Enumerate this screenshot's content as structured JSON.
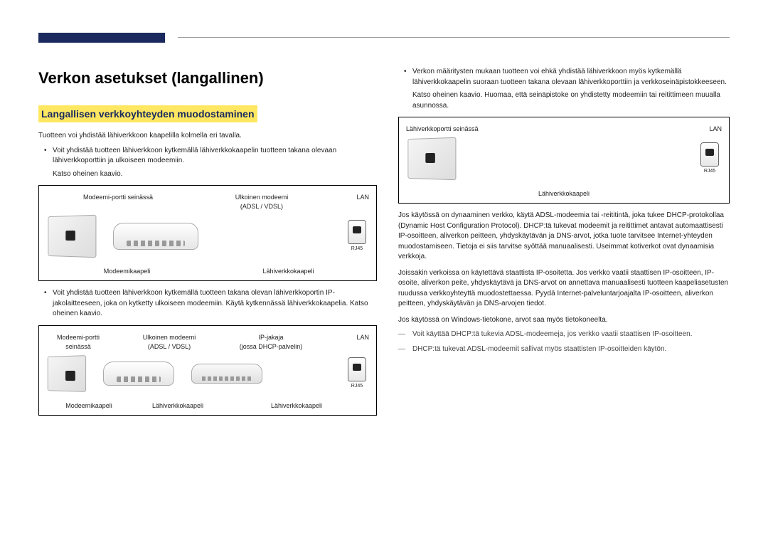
{
  "heading": "Verkon asetukset (langallinen)",
  "subheading": "Langallisen verkkoyhteyden muodostaminen",
  "intro": "Tuotteen voi yhdistää lähiverkkoon kaapelilla kolmella eri tavalla.",
  "bullet1": "Voit yhdistää tuotteen lähiverkkoon kytkemällä lähiverkkokaapelin tuotteen takana olevaan lähiverkkoporttiin ja ulkoiseen modeemiin.",
  "bullet1_sub": "Katso oheinen kaavio.",
  "bullet2": "Voit yhdistää tuotteen lähiverkkoon kytkemällä tuotteen takana olevan lähiverkkoportin IP-jakolaitteeseen, joka on kytketty ulkoiseen modeemiin. Käytä kytkennässä lähiverkkokaapelia. Katso oheinen kaavio.",
  "right_bullet": "Verkon määritysten mukaan tuotteen voi ehkä yhdistää lähiverkkoon myös kytkemällä lähiverkkokaapelin suoraan tuotteen takana olevaan lähiverkkoporttiin ja verkkoseinäpistokkeeseen.",
  "right_bullet_sub": "Katso oheinen kaavio. Huomaa, että seinäpistoke on yhdistetty modeemiin tai reitittimeen muualla asunnossa.",
  "right_p1": "Jos käytössä on dynaaminen verkko, käytä ADSL-modeemia tai -reititintä, joka tukee DHCP-protokollaa (Dynamic Host Configuration Protocol). DHCP:tä tukevat modeemit ja reitittimet antavat automaattisesti IP-osoitteen, aliverkon peitteen, yhdyskäytävän ja DNS-arvot, jotka tuote tarvitsee Internet-yhteyden muodostamiseen. Tietoja ei siis tarvitse syöttää manuaalisesti. Useimmat kotiverkot ovat dynaamisia verkkoja.",
  "right_p2": "Joissakin verkoissa on käytettävä staattista IP-osoitetta. Jos verkko vaatii staattisen IP-osoitteen, IP-osoite, aliverkon peite, yhdyskäytävä ja DNS-arvot on annettava manuaalisesti tuotteen kaapeliasetusten ruudussa verkkoyhteyttä muodostettaessa. Pyydä Internet-palveluntarjoajalta IP-osoitteen, aliverkon peitteen, yhdyskäytävän ja DNS-arvojen tiedot.",
  "right_p3": "Jos käytössä on Windows-tietokone, arvot saa myös tietokoneelta.",
  "note1": "Voit käyttää DHCP:tä tukevia ADSL-modeemeja, jos verkko vaatii staattisen IP-osoitteen.",
  "note2": "DHCP:tä tukevat ADSL-modeemit sallivat myös staattisten IP-osoitteiden käytön.",
  "labels": {
    "modem_port": "Modeemi-portti seinässä",
    "ext_modem": "Ulkoinen modeemi",
    "adsl_vdsl": "(ADSL / VDSL)",
    "ip_share": "IP-jakaja",
    "ip_share_sub": "(jossa DHCP-palvelin)",
    "lan": "LAN",
    "rj45": "RJ45",
    "modem_cable": "Modeemikaapeli",
    "lan_cable": "Lähiverkkokaapeli",
    "wall_lan_port": "Lähiverkkoportti seinässä"
  }
}
